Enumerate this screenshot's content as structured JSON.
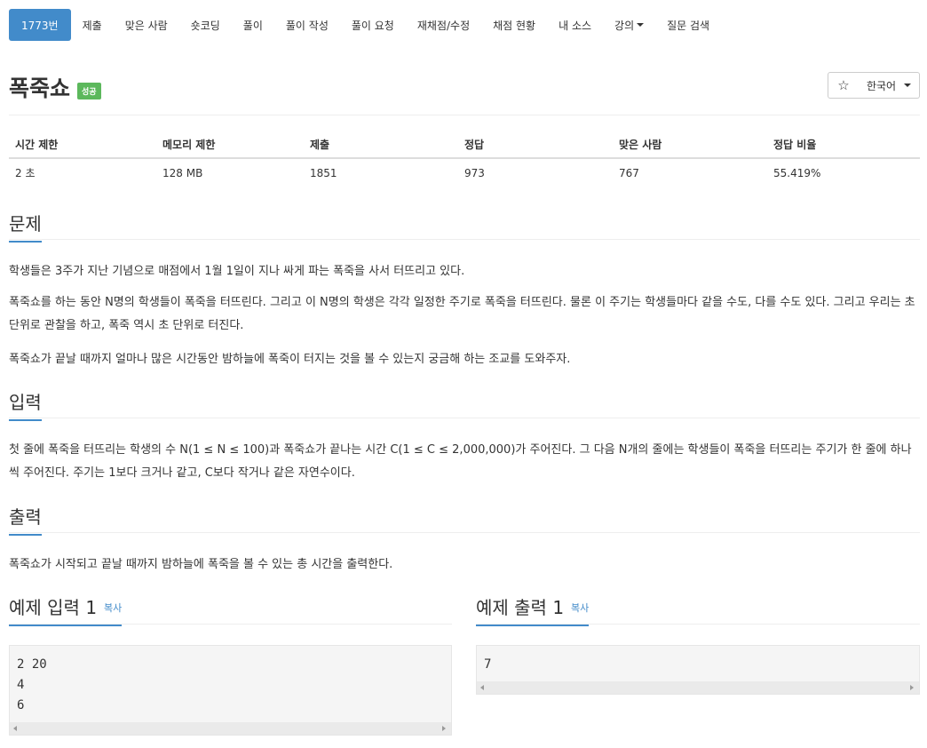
{
  "tabs": [
    {
      "label": "1773번",
      "active": true
    },
    {
      "label": "제출"
    },
    {
      "label": "맞은 사람"
    },
    {
      "label": "숏코딩"
    },
    {
      "label": "풀이"
    },
    {
      "label": "풀이 작성"
    },
    {
      "label": "풀이 요청"
    },
    {
      "label": "재채점/수정"
    },
    {
      "label": "채점 현황"
    },
    {
      "label": "내 소스"
    },
    {
      "label": "강의",
      "dropdown": true
    },
    {
      "label": "질문 검색"
    }
  ],
  "header": {
    "title": "폭죽쇼",
    "badge": "성공",
    "star": "☆",
    "language": "한국어"
  },
  "stats": {
    "headers": [
      "시간 제한",
      "메모리 제한",
      "제출",
      "정답",
      "맞은 사람",
      "정답 비율"
    ],
    "values": [
      "2 초",
      "128 MB",
      "1851",
      "973",
      "767",
      "55.419%"
    ]
  },
  "problem": {
    "heading": "문제",
    "paragraphs": [
      "학생들은 3주가 지난 기념으로 매점에서 1월 1일이 지나 싸게 파는 폭죽을 사서 터뜨리고 있다.",
      "폭죽쇼를 하는 동안 N명의 학생들이 폭죽을 터뜨린다. 그리고 이 N명의 학생은 각각 일정한 주기로 폭죽을 터뜨린다. 물론 이 주기는 학생들마다 같을 수도, 다를 수도 있다. 그리고 우리는 초 단위로 관찰을 하고, 폭죽 역시 초 단위로 터진다.",
      "폭죽쇼가 끝날 때까지 얼마나 많은 시간동안 밤하늘에 폭죽이 터지는 것을 볼 수 있는지 궁금해 하는 조교를 도와주자."
    ]
  },
  "input": {
    "heading": "입력",
    "text": "첫 줄에 폭죽을 터뜨리는 학생의 수 N(1 ≤ N ≤ 100)과 폭죽쇼가 끝나는 시간 C(1 ≤ C ≤ 2,000,000)가 주어진다. 그 다음 N개의 줄에는 학생들이 폭죽을 터뜨리는 주기가 한 줄에 하나씩 주어진다. 주기는 1보다 크거나 같고, C보다 작거나 같은 자연수이다."
  },
  "output": {
    "heading": "출력",
    "text": "폭죽쇼가 시작되고 끝날 때까지 밤하늘에 폭죽을 볼 수 있는 총 시간을 출력한다."
  },
  "example_input": {
    "heading": "예제 입력 1",
    "copy": "복사",
    "lines": [
      "2 20",
      "4",
      "6"
    ]
  },
  "example_output": {
    "heading": "예제 출력 1",
    "copy": "복사",
    "lines": [
      "7"
    ]
  }
}
